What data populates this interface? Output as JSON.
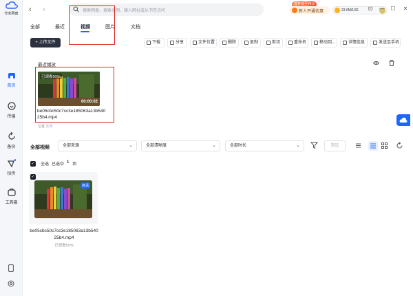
{
  "app": {
    "name": "夸克网盘"
  },
  "rail": {
    "items": [
      {
        "label": "首页",
        "icon": "home-icon",
        "active": true
      },
      {
        "label": "传输",
        "icon": "transfer-icon",
        "active": false
      },
      {
        "label": "备份",
        "icon": "backup-icon",
        "active": false
      },
      {
        "label": "快传",
        "icon": "quick-transfer-icon",
        "active": false
      },
      {
        "label": "工具箱",
        "icon": "toolbox-icon",
        "active": false
      }
    ]
  },
  "search": {
    "placeholder": "搜索网盘、搜索全网、输入网址或从书签访问"
  },
  "vip": {
    "badge": "首开低至¥4.8",
    "button": "新人开通优惠"
  },
  "storage": {
    "text": "23.6M/10G"
  },
  "window": {
    "pin": "⊡",
    "minimize": "—",
    "maximize": "☐",
    "close": "✕"
  },
  "tabs": [
    "全部",
    "最近",
    "视频",
    "图片",
    "文档"
  ],
  "active_tab": "视频",
  "upload": {
    "label": "+ 上传文件"
  },
  "actions": [
    "下载",
    "分享",
    "文件位置",
    "删除",
    "复制",
    "剪切",
    "重命名",
    "移动到...",
    "详情信息",
    "发送至手机"
  ],
  "recent": {
    "title": "最近播放",
    "played": "已观看50%",
    "duration": "00:00:02",
    "filename": "be05cbc50c7cc3e185063a13b54025b4.mp4",
    "location": "位置 文件"
  },
  "filters": {
    "title": "全部视频",
    "source": "全部来源",
    "resolution": "全部清晰度",
    "length": "全部时长",
    "filter_btn": "筛选"
  },
  "selection": {
    "all": "全选",
    "selected": "已选中",
    "count": "1",
    "unit": "项"
  },
  "card": {
    "badge": "高清",
    "filename": "be05cbc50c7cc3e185063a13b54025b4.mp4",
    "meta": "已观看50%"
  }
}
